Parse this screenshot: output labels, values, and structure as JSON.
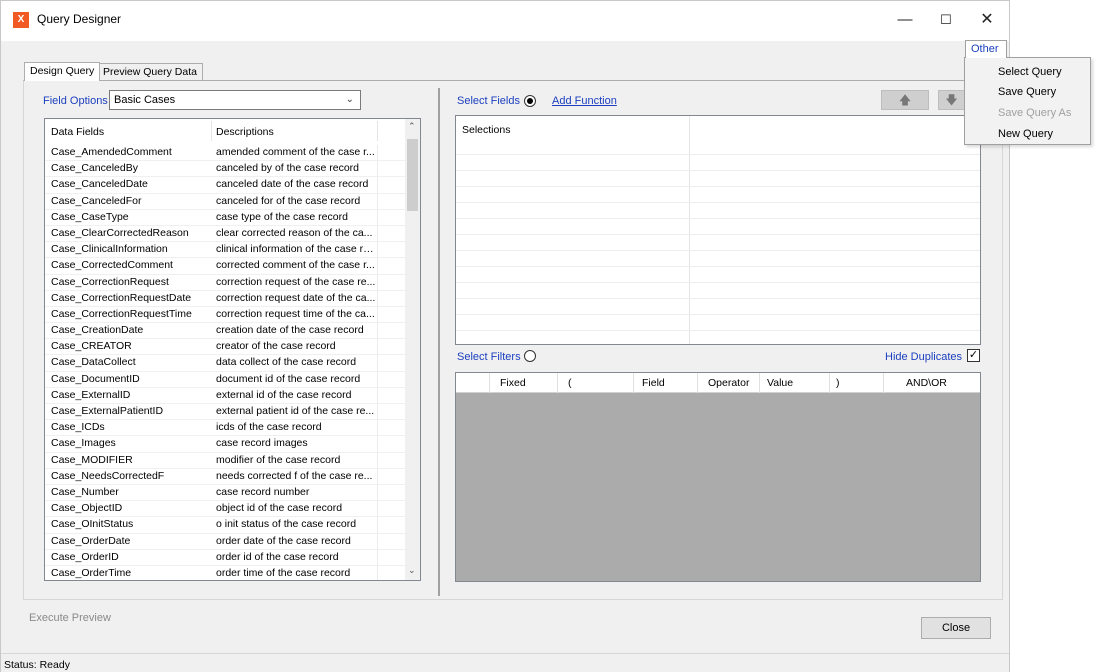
{
  "window": {
    "title": "Query Designer",
    "icon_label": "X",
    "controls": {
      "minimize": "—",
      "maximize": "☐",
      "close": "✕"
    }
  },
  "tabs": [
    {
      "label": "Design Query",
      "active": true
    },
    {
      "label": "Preview Query Data",
      "active": false
    }
  ],
  "field_options": {
    "label": "Field Options",
    "selected": "Basic Cases"
  },
  "data_fields_grid": {
    "columns": [
      "Data Fields",
      "Descriptions"
    ],
    "rows": [
      [
        "Case_AmendedComment",
        "amended comment of the case r..."
      ],
      [
        "Case_CanceledBy",
        "canceled by of the case record"
      ],
      [
        "Case_CanceledDate",
        "canceled date of the case record"
      ],
      [
        "Case_CanceledFor",
        "canceled for of the case record"
      ],
      [
        "Case_CaseType",
        "case type of the case record"
      ],
      [
        "Case_ClearCorrectedReason",
        "clear corrected reason of the ca..."
      ],
      [
        "Case_ClinicalInformation",
        "clinical information of the case re..."
      ],
      [
        "Case_CorrectedComment",
        "corrected comment of the case r..."
      ],
      [
        "Case_CorrectionRequest",
        "correction request of the case re..."
      ],
      [
        "Case_CorrectionRequestDate",
        "correction request date of the ca..."
      ],
      [
        "Case_CorrectionRequestTime",
        "correction request time of the ca..."
      ],
      [
        "Case_CreationDate",
        "creation date of the case record"
      ],
      [
        "Case_CREATOR",
        "creator of the case record"
      ],
      [
        "Case_DataCollect",
        "data collect of the case record"
      ],
      [
        "Case_DocumentID",
        "document id of the case record"
      ],
      [
        "Case_ExternalID",
        "external id of the case record"
      ],
      [
        "Case_ExternalPatientID",
        "external patient id of the case re..."
      ],
      [
        "Case_ICDs",
        "icds of the case record"
      ],
      [
        "Case_Images",
        "case record images"
      ],
      [
        "Case_MODIFIER",
        "modifier of the case record"
      ],
      [
        "Case_NeedsCorrectedF",
        "needs corrected f of the case re..."
      ],
      [
        "Case_Number",
        "case record number"
      ],
      [
        "Case_ObjectID",
        "object id of the case record"
      ],
      [
        "Case_OInitStatus",
        "o init status of the case record"
      ],
      [
        "Case_OrderDate",
        "order date of the case record"
      ],
      [
        "Case_OrderID",
        "order id of the case record"
      ],
      [
        "Case_OrderTime",
        "order time of the case record"
      ]
    ]
  },
  "select_fields": {
    "label": "Select Fields",
    "add_function": "Add Function",
    "up_arrow": "🡅",
    "down_arrow": "🡇"
  },
  "selections_grid": {
    "header": "Selections"
  },
  "select_filters": {
    "label": "Select Filters",
    "hide_duplicates": "Hide Duplicates",
    "checkmark": "✓"
  },
  "filters_grid": {
    "columns": [
      "Fixed",
      "(",
      "Field",
      "Operator",
      "Value",
      ")",
      "AND\\OR"
    ]
  },
  "execute_preview": "Execute Preview",
  "close_button": "Close",
  "status": "Status: Ready",
  "other_menu": {
    "label": "Other",
    "items": [
      {
        "label": "Select Query",
        "enabled": true
      },
      {
        "label": "Save Query",
        "enabled": true
      },
      {
        "label": "Save Query As",
        "enabled": false
      },
      {
        "label": "New Query",
        "enabled": true
      }
    ]
  }
}
